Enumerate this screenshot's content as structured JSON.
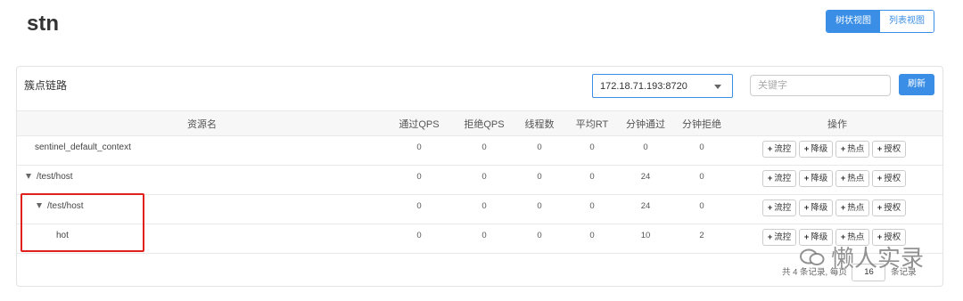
{
  "app_title": "stn",
  "view_toggle": {
    "tree": "树状视图",
    "list": "列表视图"
  },
  "panel": {
    "title": "簇点链路",
    "machine": "172.18.71.193:8720",
    "search_placeholder": "关键字",
    "refresh": "刷新"
  },
  "table": {
    "headers": {
      "resource": "资源名",
      "pass_qps": "通过QPS",
      "block_qps": "拒绝QPS",
      "threads": "线程数",
      "avg_rt": "平均RT",
      "minute_pass": "分钟通过",
      "minute_block": "分钟拒绝",
      "ops": "操作"
    },
    "op_labels": {
      "flow": "流控",
      "degrade": "降级",
      "hotspot": "热点",
      "authority": "授权"
    },
    "rows": [
      {
        "name": "sentinel_default_context",
        "pass_qps": "0",
        "block_qps": "0",
        "threads": "0",
        "avg_rt": "0",
        "minute_pass": "0",
        "minute_block": "0"
      },
      {
        "name": "/test/host",
        "pass_qps": "0",
        "block_qps": "0",
        "threads": "0",
        "avg_rt": "0",
        "minute_pass": "24",
        "minute_block": "0"
      },
      {
        "name": "/test/host",
        "pass_qps": "0",
        "block_qps": "0",
        "threads": "0",
        "avg_rt": "0",
        "minute_pass": "24",
        "minute_block": "0"
      },
      {
        "name": "hot",
        "pass_qps": "0",
        "block_qps": "0",
        "threads": "0",
        "avg_rt": "0",
        "minute_pass": "10",
        "minute_block": "2"
      }
    ]
  },
  "pager": {
    "prefix": "共 4 条记录, 每页",
    "page_size": "16",
    "suffix": "条记录"
  },
  "watermark": "懒人实录",
  "colors": {
    "accent": "#3a8ee6",
    "highlight": "#e0201b"
  }
}
